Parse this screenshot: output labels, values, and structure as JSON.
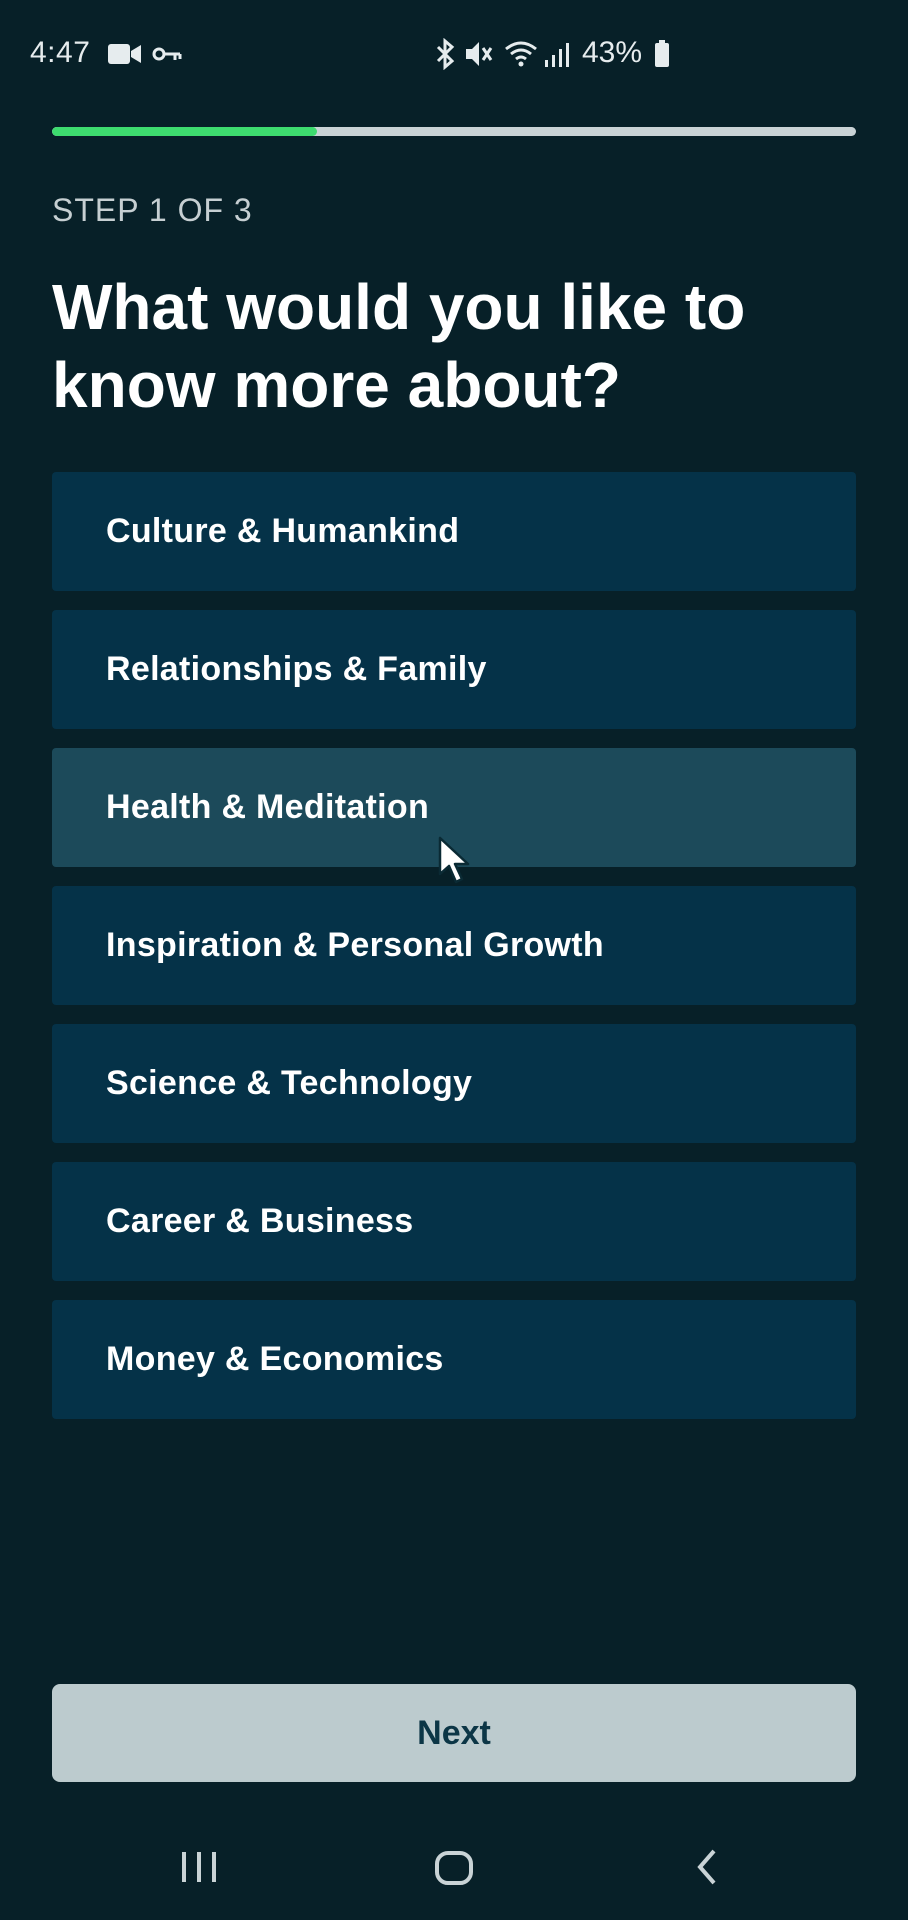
{
  "status_bar": {
    "time": "4:47",
    "battery_percent": "43%",
    "icons": [
      "video-camera-icon",
      "vpn-key-icon",
      "bluetooth-icon",
      "mute-icon",
      "wifi-icon",
      "signal-icon",
      "battery-icon"
    ]
  },
  "progress": {
    "value": 0.33,
    "fill_color": "#3ddc6f",
    "track_color": "#c9d3d6"
  },
  "step_label": "STEP 1 OF 3",
  "question": "What would you like to know more about?",
  "topics": [
    {
      "label": "Culture & Humankind"
    },
    {
      "label": "Relationships & Family"
    },
    {
      "label": "Health & Meditation"
    },
    {
      "label": "Inspiration & Personal Growth"
    },
    {
      "label": "Science & Technology"
    },
    {
      "label": "Career & Business"
    },
    {
      "label": "Money & Economics"
    }
  ],
  "next_button": {
    "label": "Next"
  },
  "nav_bar": {
    "icons": [
      "recent-apps-icon",
      "home-icon",
      "back-icon"
    ]
  },
  "colors": {
    "background": "#072028",
    "topic_background": "#053248",
    "topic_hover": "#1c4a5a",
    "button_background": "#bccbce"
  }
}
